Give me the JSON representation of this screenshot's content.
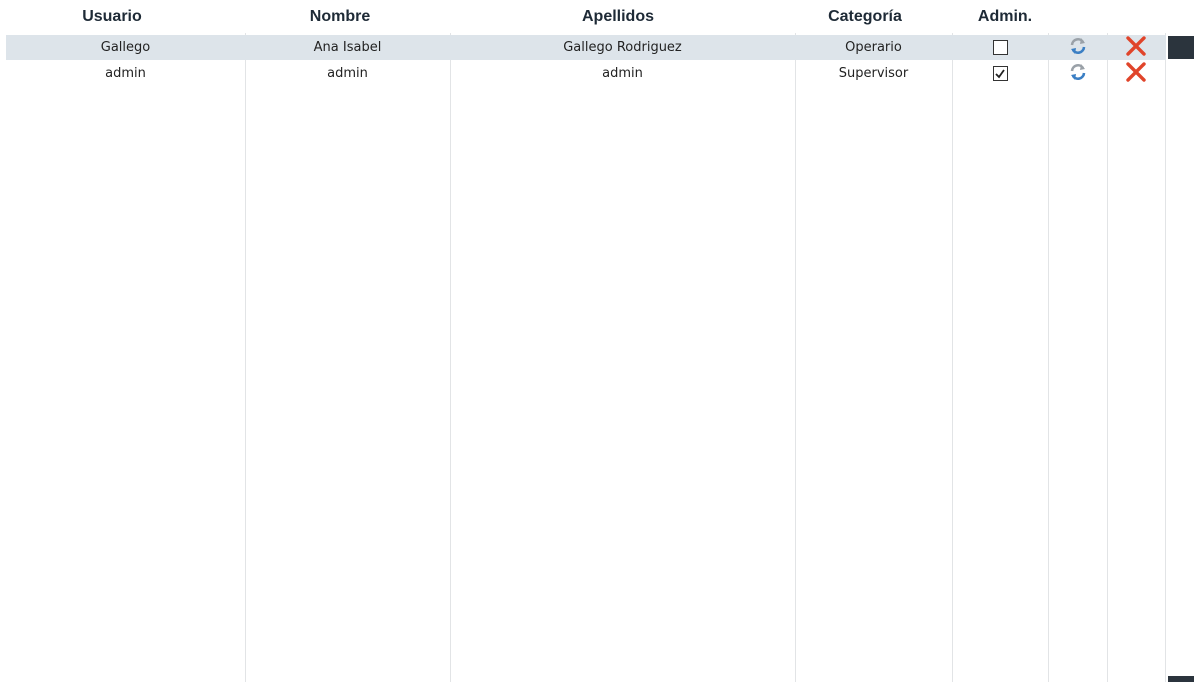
{
  "headers": {
    "usuario": "Usuario",
    "nombre": "Nombre",
    "apellidos": "Apellidos",
    "categoria": "Categoría",
    "admin": "Admin."
  },
  "rows": [
    {
      "usuario": "Gallego",
      "nombre": "Ana Isabel",
      "apellidos": "Gallego Rodriguez",
      "categoria": "Operario",
      "admin": false,
      "selected": true
    },
    {
      "usuario": "admin",
      "nombre": "admin",
      "apellidos": "admin",
      "categoria": "Supervisor",
      "admin": true,
      "selected": false
    }
  ],
  "icons": {
    "refresh": "refresh-icon",
    "delete": "delete-icon"
  },
  "colors": {
    "selected_row": "#dde4ea",
    "refresh_blue": "#3b7fc4",
    "refresh_gray": "#9aa1a8",
    "delete_red": "#e0442a",
    "scroll_dark": "#2b343d"
  }
}
